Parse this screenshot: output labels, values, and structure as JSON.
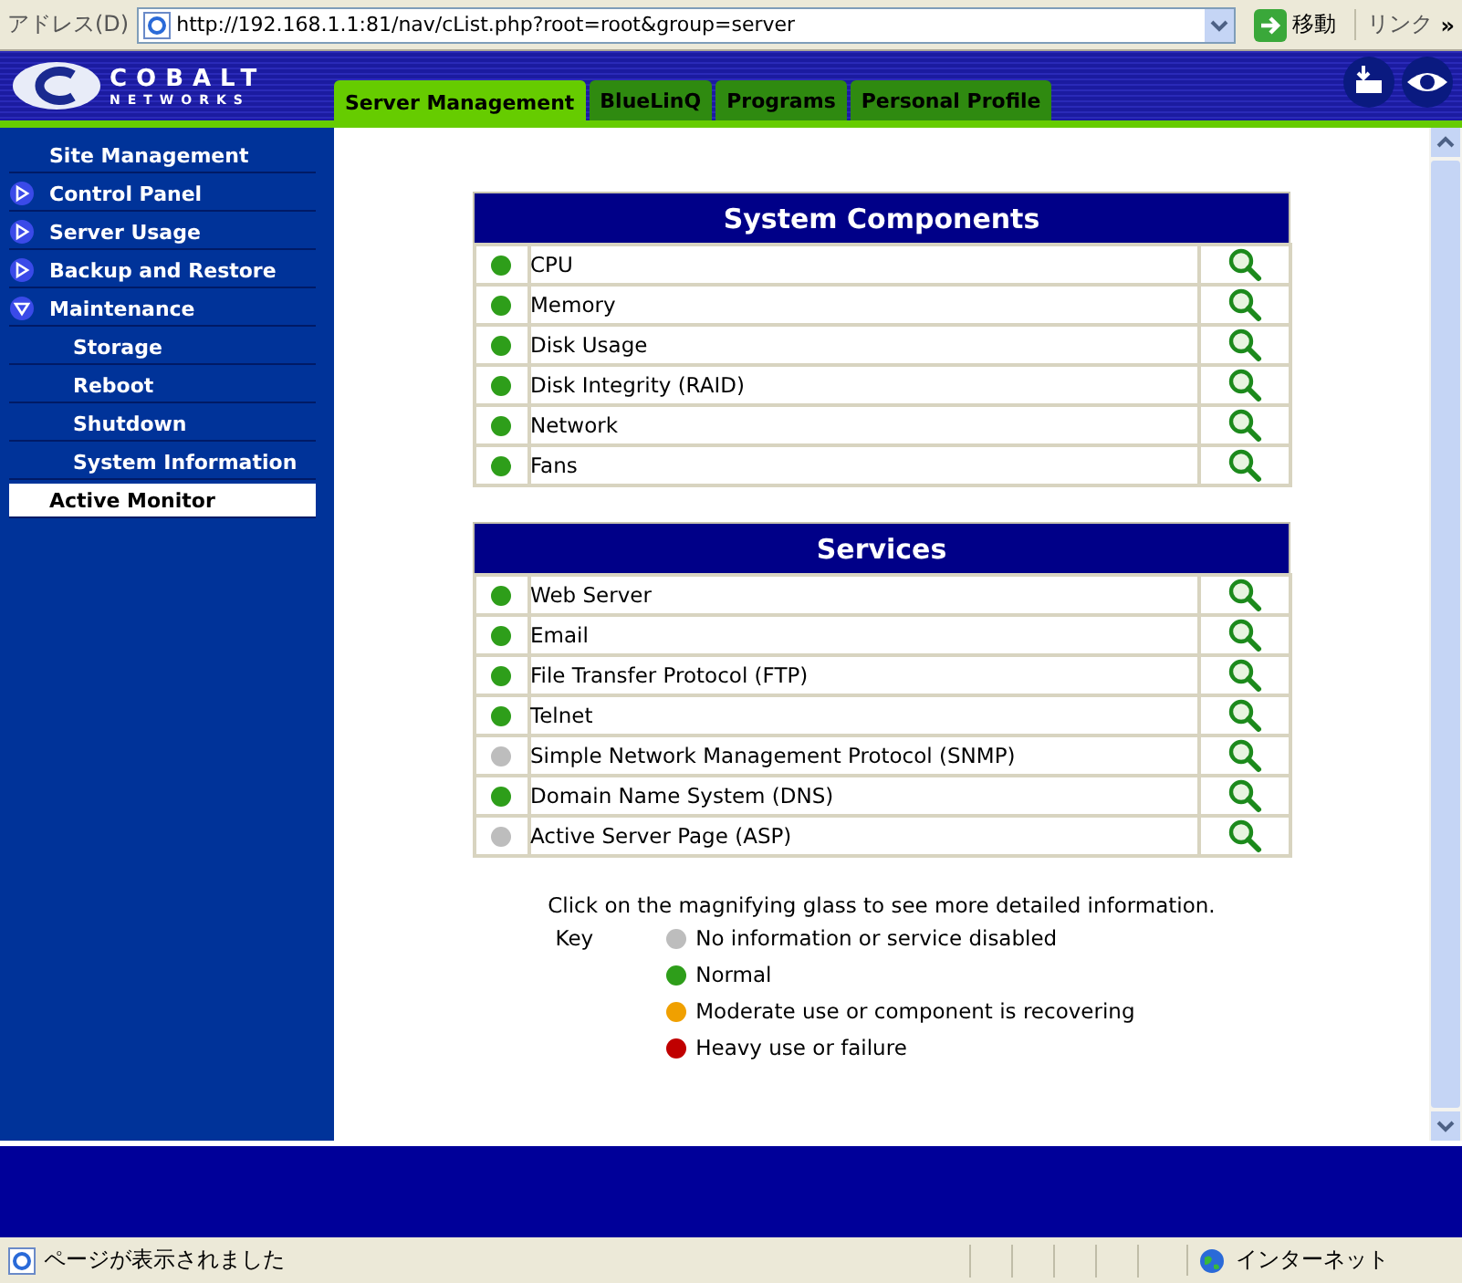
{
  "address_bar": {
    "label": "アドレス(D)",
    "url": "http://192.168.1.1:81/nav/cList.php?root=root&group=server",
    "go": "移動",
    "links": "リンク",
    "more": "»"
  },
  "logo": {
    "title": "COBALT",
    "subtitle": "NETWORKS"
  },
  "tabs": [
    {
      "label": "Server Management",
      "selected": true
    },
    {
      "label": "BlueLinQ",
      "selected": false
    },
    {
      "label": "Programs",
      "selected": false
    },
    {
      "label": "Personal Profile",
      "selected": false
    }
  ],
  "sidebar": {
    "items": [
      {
        "label": "Site Management",
        "selected": false,
        "kind": "header"
      },
      {
        "label": "Control Panel",
        "selected": false,
        "kind": "folder",
        "expanded": false
      },
      {
        "label": "Server Usage",
        "selected": false,
        "kind": "folder",
        "expanded": false
      },
      {
        "label": "Backup and Restore",
        "selected": false,
        "kind": "folder",
        "expanded": false
      },
      {
        "label": "Maintenance",
        "selected": false,
        "kind": "folder",
        "expanded": true,
        "children": [
          {
            "label": "Storage",
            "selected": false
          },
          {
            "label": "Reboot",
            "selected": false
          },
          {
            "label": "Shutdown",
            "selected": false
          },
          {
            "label": "System Information",
            "selected": false
          }
        ]
      },
      {
        "label": "Active Monitor",
        "selected": true,
        "kind": "header"
      }
    ]
  },
  "tables": [
    {
      "title": "System Components",
      "rows": [
        {
          "name": "CPU",
          "color": "#2e9e1a"
        },
        {
          "name": "Memory",
          "color": "#2e9e1a"
        },
        {
          "name": "Disk Usage",
          "color": "#2e9e1a"
        },
        {
          "name": "Disk Integrity (RAID)",
          "color": "#2e9e1a"
        },
        {
          "name": "Network",
          "color": "#2e9e1a"
        },
        {
          "name": "Fans",
          "color": "#2e9e1a"
        }
      ]
    },
    {
      "title": "Services",
      "rows": [
        {
          "name": "Web Server",
          "color": "#2e9e1a"
        },
        {
          "name": "Email",
          "color": "#2e9e1a"
        },
        {
          "name": "File Transfer Protocol (FTP)",
          "color": "#2e9e1a"
        },
        {
          "name": "Telnet",
          "color": "#2e9e1a"
        },
        {
          "name": "Simple Network Management Protocol (SNMP)",
          "color": "#bdbdbd"
        },
        {
          "name": "Domain Name System (DNS)",
          "color": "#2e9e1a"
        },
        {
          "name": "Active Server Page (ASP)",
          "color": "#bdbdbd"
        }
      ]
    }
  ],
  "hint": "Click on the magnifying glass to see more detailed information.",
  "key": {
    "label": "Key",
    "items": [
      {
        "color": "#bdbdbd",
        "label": "No information or service disabled"
      },
      {
        "color": "#2e9e1a",
        "label": "Normal"
      },
      {
        "color": "#f0a000",
        "label": "Moderate use or component is recovering"
      },
      {
        "color": "#c00000",
        "label": "Heavy use or failure"
      }
    ]
  },
  "status_bar": {
    "message": "ページが表示されました",
    "zone": "インターネット"
  }
}
